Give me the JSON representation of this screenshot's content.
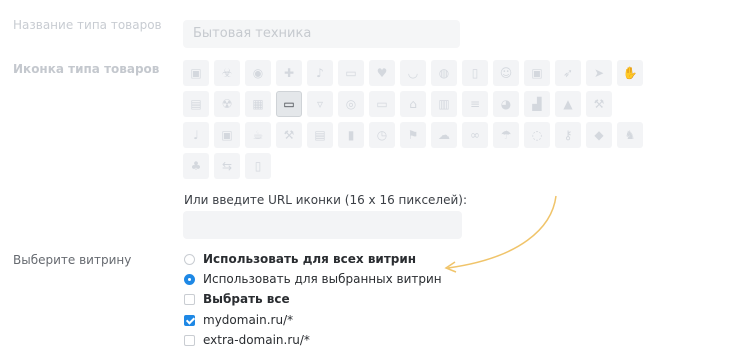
{
  "form": {
    "type_name_label": "Название типа товаров",
    "type_name_value": "Бытовая техника",
    "icon_label": "Иконка типа товаров",
    "url_label": "Или введите URL иконки (16 х 16 пикселей):",
    "url_value": "",
    "storefront_label": "Выберите витрину",
    "options": {
      "all": "Использовать для всех витрин",
      "selected": "Использовать для выбранных витрин",
      "select_all": "Выбрать все",
      "domain1": "mydomain.ru/*",
      "domain2": "extra-domain.ru/*"
    },
    "state": {
      "radio_selected": "selected",
      "select_all_checked": false,
      "domain1_checked": true,
      "domain2_checked": false
    }
  },
  "icons": [
    "gift-icon",
    "biohazard-icon",
    "soccer-icon",
    "cake-icon",
    "music-icon",
    "car-icon",
    "heart-icon",
    "headphones-icon",
    "globe-icon",
    "phone-icon",
    "smile-icon",
    "camera-icon",
    "rocket-icon",
    "plane-icon",
    "handshake-icon",
    "giftbox-icon",
    "radiation-icon",
    "map-icon",
    "monitor-icon",
    "tshirt-icon",
    "disc-icon",
    "laptop-icon",
    "bank-icon",
    "briefcase-icon",
    "burger-icon",
    "palette-icon",
    "hat-icon",
    "warning-icon",
    "hammer-icon",
    "guitar-icon",
    "floppy-icon",
    "coffee-icon",
    "gavel-icon",
    "archive-icon",
    "traffic-light-icon",
    "clock-icon",
    "chair-icon",
    "cloud-download-icon",
    "glasses-icon",
    "umbrella-icon",
    "gamepad-icon",
    "key-icon",
    "fish-icon",
    "cat-icon",
    "paw-icon",
    "usb-icon",
    "speaker-icon"
  ]
}
